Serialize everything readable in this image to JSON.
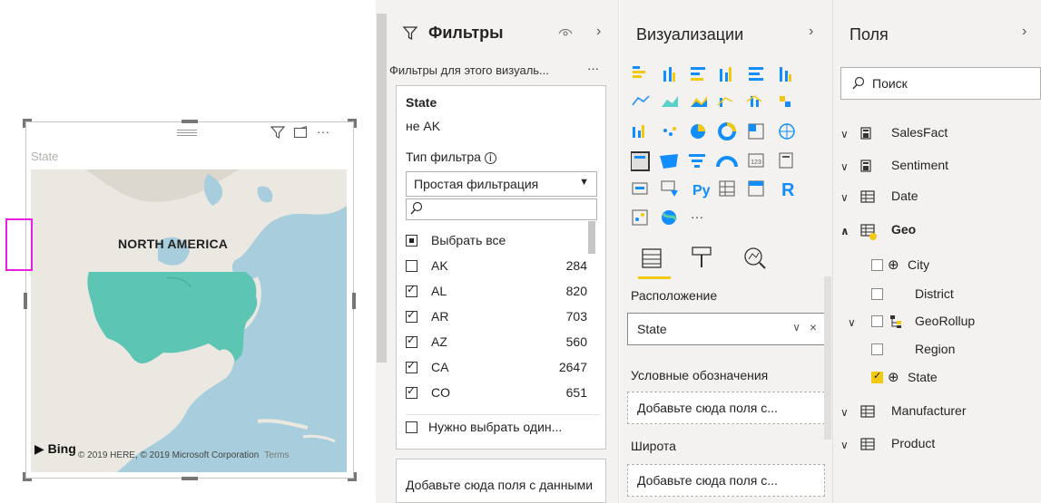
{
  "visual": {
    "title": "State",
    "map_label": "NORTH AMERICA",
    "brand": "Bing",
    "copyright": "© 2019 HERE, © 2019 Microsoft Corporation",
    "terms": "Terms"
  },
  "filters": {
    "title": "Фильтры",
    "subtitle": "Фильтры для этого визуаль...",
    "more": "···",
    "card": {
      "field": "State",
      "summary": "не AK",
      "filter_type_label": "Тип фильтра",
      "filter_type_value": "Простая фильтрация",
      "select_all": "Выбрать все",
      "items": [
        {
          "label": "AK",
          "count": "284",
          "checked": false
        },
        {
          "label": "AL",
          "count": "820",
          "checked": true
        },
        {
          "label": "AR",
          "count": "703",
          "checked": true
        },
        {
          "label": "AZ",
          "count": "560",
          "checked": true
        },
        {
          "label": "CA",
          "count": "2647",
          "checked": true
        },
        {
          "label": "CO",
          "count": "651",
          "checked": true
        }
      ],
      "require_one": "Нужно выбрать один..."
    },
    "add_field": "Добавьте сюда поля с данными"
  },
  "visualizations": {
    "title": "Визуализации",
    "more": "···",
    "sections": {
      "location": "Расположение",
      "location_value": "State",
      "legend": "Условные обозначения",
      "legend_placeholder": "Добавьте сюда поля с...",
      "latitude": "Широта",
      "latitude_placeholder": "Добавьте сюда поля с..."
    },
    "icon_labels": {
      "python": "Py",
      "r": "R",
      "number": "123"
    }
  },
  "fields": {
    "title": "Поля",
    "search_placeholder": "Поиск",
    "tables": [
      {
        "name": "SalesFact",
        "expanded": false
      },
      {
        "name": "Sentiment",
        "expanded": false
      },
      {
        "name": "Date",
        "expanded": false
      },
      {
        "name": "Geo",
        "expanded": true
      },
      {
        "name": "Manufacturer",
        "expanded": false
      },
      {
        "name": "Product",
        "expanded": false
      }
    ],
    "geo_fields": [
      {
        "name": "City",
        "checked": false
      },
      {
        "name": "District",
        "checked": false
      },
      {
        "name": "GeoRollup",
        "checked": false
      },
      {
        "name": "Region",
        "checked": false
      },
      {
        "name": "State",
        "checked": true
      }
    ]
  },
  "colors": {
    "accent": "#f2c811",
    "map_fill": "#5cc5b3",
    "map_water": "#a8cddc",
    "highlight": "#e91ee6"
  }
}
